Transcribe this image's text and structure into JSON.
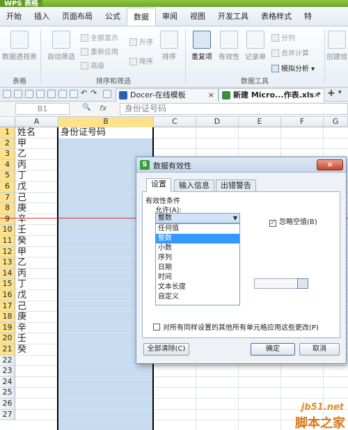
{
  "titlebar": {
    "app_name": "WPS 表格"
  },
  "ribbon_tabs": [
    "开始",
    "插入",
    "页面布局",
    "公式",
    "数据",
    "审阅",
    "视图",
    "开发工具",
    "表格样式",
    "特"
  ],
  "active_tab": "数据",
  "ribbon": {
    "pivot": "数据透视表",
    "autofilter": "自动筛选",
    "show_all": "全部显示",
    "reapply": "重新应用",
    "advanced": "高级",
    "sort_asc": "升序",
    "sort_desc": "降序",
    "sort": "排序",
    "duplicates": "重复项",
    "validity": "有效性",
    "record": "记录单",
    "split": "分列",
    "merge_calc": "合并计算",
    "whatif": "模拟分析",
    "create_group": "创建组",
    "groups": {
      "table": "表格",
      "sort_filter": "排序和筛选",
      "data_tools": "数据工具"
    }
  },
  "doc_tabs": [
    {
      "label": "Docer-在线模板",
      "close": "×"
    },
    {
      "label": "新建 Micro...作表.xls *",
      "close": "×"
    }
  ],
  "formula_bar": {
    "cell_ref": "B1",
    "fx": "fx",
    "zoom": "🔍",
    "content": "身份证号码"
  },
  "columns": [
    "A",
    "B",
    "C",
    "D",
    "E",
    "F",
    "G"
  ],
  "rows": [
    "1",
    "2",
    "3",
    "4",
    "5",
    "6",
    "7",
    "8",
    "9",
    "10",
    "11",
    "12",
    "13",
    "14",
    "15",
    "16",
    "17",
    "18",
    "19",
    "20",
    "21",
    "22",
    "23",
    "24",
    "25",
    "26",
    "27"
  ],
  "cells_a": [
    "姓名",
    "甲",
    "乙",
    "丙",
    "丁",
    "戊",
    "己",
    "庚",
    "辛",
    "壬",
    "癸",
    "甲",
    "乙",
    "丙",
    "丁",
    "戊",
    "己",
    "庚",
    "辛",
    "壬",
    "癸"
  ],
  "cell_b1": "身份证号码",
  "dialog": {
    "title": "数据有效性",
    "close_label": "×",
    "tabs": [
      "设置",
      "输入信息",
      "出错警告"
    ],
    "section": "有效性条件",
    "allow_label": "允许(A):",
    "allow_value": "整数",
    "allow_options": [
      "任何值",
      "整数",
      "小数",
      "序列",
      "日期",
      "时间",
      "文本长度",
      "自定义"
    ],
    "ignore_blank": "忽略空值(B)",
    "apply_all": "对所有同样设置的其他所有单元格应用这些更改(P)",
    "clear_all": "全部清除(C)",
    "ok": "确定",
    "cancel": "取消"
  },
  "watermark": {
    "site": "jb51.net",
    "cn": "脚本之家"
  }
}
